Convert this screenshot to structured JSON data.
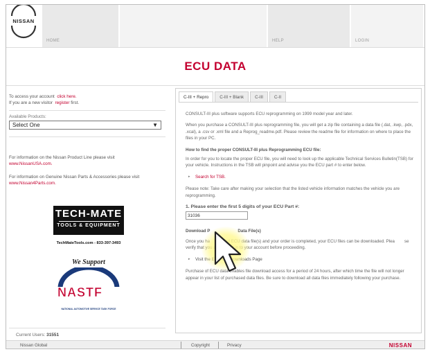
{
  "brand": {
    "logo_text": "NISSAN",
    "accent": "#c3002f"
  },
  "header": {
    "nav": [
      {
        "label": "HOME"
      },
      {
        "label": ""
      },
      {
        "label": "HELP"
      },
      {
        "label": "LOGIN"
      }
    ]
  },
  "page_title": "ECU DATA",
  "left": {
    "login_prompt": "To access your account",
    "login_link": "click here.",
    "new_visitor_prompt": "If you are a new visitor",
    "register_link": "register",
    "register_suffix": "first.",
    "products_label": "Available Products:",
    "products_selected": "Select One",
    "product_line_info": "For information on the Nissan Product Line please visit",
    "product_line_link": "www.NissanUSA.com.",
    "parts_info": "For information on Genuine Nissan Parts & Accessories please visit",
    "parts_link": "www.Nissan4Parts.com.",
    "techmate": {
      "name": "TECH-MATE",
      "sub": "TOOLS & EQUIPMENT",
      "web": "TechMateTools.com - 833-397-3493"
    },
    "we_support": "We Support",
    "nastf": {
      "name": "NASTF",
      "full": "NATIONAL AUTOMOTIVE SERVICE TASK FORCE"
    },
    "current_users_label": "Current Users:",
    "current_users_value": "31551"
  },
  "tabs": [
    {
      "label": "C-III + Repro",
      "active": true
    },
    {
      "label": "C-III + Blank",
      "active": false
    },
    {
      "label": "C-III",
      "active": false
    },
    {
      "label": "C-II",
      "active": false
    }
  ],
  "content": {
    "p1": "CONSULT-III plus software supports ECU reprogramming on 1999 model year and later.",
    "p2": "When you purchase a CONSULT-III plus reprogramming file, you will get a zip file containing a data file (.dat, .kwp, .pdx, .xcal), a .csv or .xml file and a Reprog_readme.pdf. Please review the readme file for information on where to place the files in your PC.",
    "how_heading": "How to find the proper CONSULT-III plus Reprogramming ECU file:",
    "p3": "In order for you to locate the proper ECU file, you will need to look up the applicable Technical Services Bulletin(TSB) for your vehicle. Instructions in the TSB will pinpoint and advise you the ECU part # to enter below.",
    "search_tsb": "Search for TSB.",
    "note": "Please note: Take care after making your selection that the listed vehicle information matches the vehicle you are reprogramming.",
    "step1": "1. Please enter the first 5 digits of your ECU Part #:",
    "part_value": "31036",
    "download_heading_a": "Download P",
    "download_heading_b": "Data File(s)",
    "p4a": "Once you ha",
    "p4b": "ed ECU data file(s) and your order is completed, your ECU files can be downloaded. Plea",
    "p4c": "se verify that you are logged in to your account before proceeding.",
    "visit_link": "Visit the ECU File Downloads Page",
    "p5": "Purchase of ECU data enables file download access for a period of 24 hours, after which time the file will not longer appear in your list of purchased data files. Be sure to download all data files immediately following your purchase."
  },
  "footer": {
    "left": "Nissan Global",
    "copyright": "Copyright",
    "privacy": "Privacy",
    "brand": "NISSAN"
  }
}
